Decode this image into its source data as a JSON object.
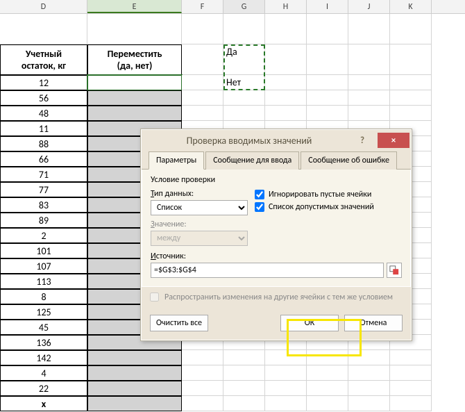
{
  "columns": [
    "D",
    "E",
    "F",
    "G",
    "H",
    "I",
    "J",
    "K"
  ],
  "header": {
    "d": "Учетный\nостаток, кг",
    "e": "Переместить\n(да, нет)"
  },
  "d_values": [
    "12",
    "56",
    "48",
    "11",
    "88",
    "66",
    "71",
    "77",
    "83",
    "89",
    "2",
    "101",
    "107",
    "113",
    "8",
    "125",
    "45",
    "136",
    "142",
    "4",
    "22",
    "x"
  ],
  "g_options": [
    "Да",
    "Нет"
  ],
  "dialog": {
    "title": "Проверка вводимых значений",
    "tabs": [
      "Параметры",
      "Сообщение для ввода",
      "Сообщение об ошибке"
    ],
    "group_title": "Условие проверки",
    "type_label": "Тип данных:",
    "type_value": "Список",
    "value_label": "Значение:",
    "value_value": "между",
    "source_label": "Источник:",
    "source_value": "=$G$3:$G$4",
    "ignore_blanks": "Игнорировать пустые ячейки",
    "dropdown_list": "Список допустимых значений",
    "propagate": "Распространить изменения на другие ячейки с тем же условием",
    "clear_all": "Очистить все",
    "ok": "ОК",
    "cancel": "Отмена",
    "help": "?",
    "close": "×"
  }
}
